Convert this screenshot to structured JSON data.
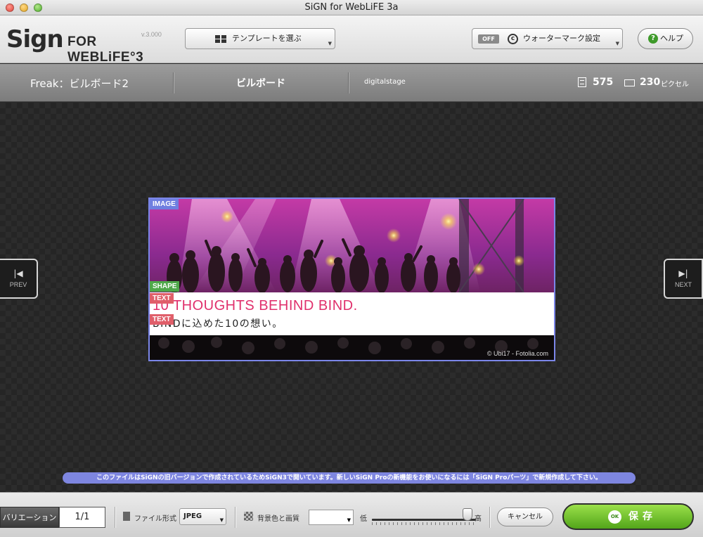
{
  "window": {
    "title": "SiGN for WebLiFE 3a"
  },
  "toolbar": {
    "logo_main": "Sign",
    "logo_sub": "FOR WEBLiFE°3",
    "version": "v.3.000",
    "template_button": "テンプレートを選ぶ",
    "watermark_toggle": "OFF",
    "watermark_label": "ウォーターマーク設定",
    "help_label": "ヘルプ"
  },
  "info": {
    "template_name": "Freak：ビルボード2",
    "category": "ビルボード",
    "author": "digitalstage",
    "height": "575",
    "width": "230",
    "unit": "ピクセル"
  },
  "canvas": {
    "prev_label": "PREV",
    "next_label": "NEXT",
    "headline": "10 THOUGHTS BEHIND BIND.",
    "subtext": "BINDに込めた10の想い。",
    "credit": "© Ubi17 - Fotolia.com",
    "tags": {
      "image": "IMAGE",
      "shape": "SHAPE",
      "text": "TEXT"
    },
    "notice": "このファイルはSiGNの旧バージョンで作成されているためSiGN3で開いています。新しいSiGN Proの新機能をお使いになるには「SiGN Proパーツ」で新規作成して下さい。"
  },
  "bottom": {
    "variation_label": "バリエーション",
    "variation_value": "1/1",
    "format_label": "ファイル形式",
    "format_value": "JPEG",
    "bg_label": "背景色と画質",
    "quality_low": "低",
    "quality_high": "高",
    "quality_level": 0.92,
    "cancel_label": "キャンセル",
    "save_ok": "OK",
    "save_label": "保存"
  },
  "colors": {
    "accent_blue": "#7b86e8",
    "headline_pink": "#e0306c",
    "save_green": "#6ec22e",
    "shape_tag": "#4fa84a",
    "text_tag": "#e05f6a"
  }
}
